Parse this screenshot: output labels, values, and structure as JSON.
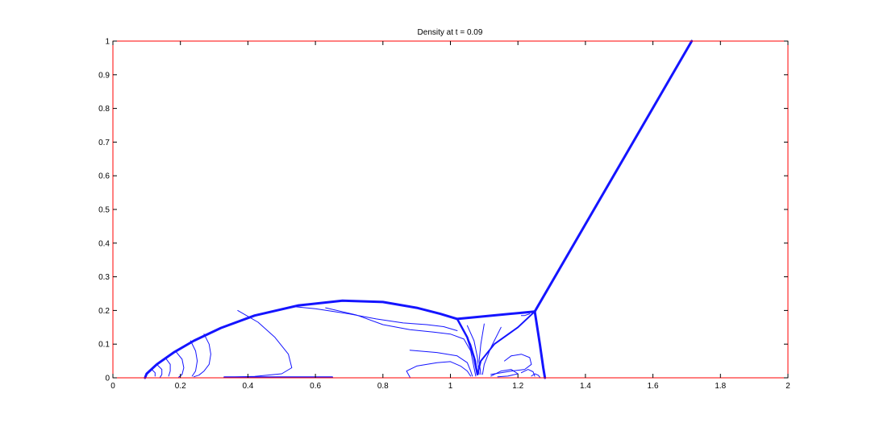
{
  "chart_data": {
    "type": "line",
    "title": "Density at t = 0.09",
    "xlabel": "",
    "ylabel": "",
    "xlim": [
      0,
      2
    ],
    "ylim": [
      0,
      1
    ],
    "grid": false,
    "x_ticks": [
      0,
      0.2,
      0.4,
      0.6,
      0.8,
      1,
      1.2,
      1.4,
      1.6,
      1.8,
      2
    ],
    "x_tick_labels": [
      "0",
      "0.2",
      "0.4",
      "0.6",
      "0.8",
      "1",
      "1.2",
      "1.4",
      "1.6",
      "1.8",
      "2"
    ],
    "y_ticks": [
      0,
      0.1,
      0.2,
      0.3,
      0.4,
      0.5,
      0.6,
      0.7,
      0.8,
      0.9,
      1
    ],
    "y_tick_labels": [
      "0",
      "0.1",
      "0.2",
      "0.3",
      "0.4",
      "0.5",
      "0.6",
      "0.7",
      "0.8",
      "0.9",
      "1"
    ],
    "colors": {
      "contour": "#1414ff",
      "frame": "#ff0000",
      "tick": "#000000"
    },
    "series": [
      {
        "width": 3,
        "points": [
          [
            0.095,
            0
          ],
          [
            0.1,
            0.012
          ],
          [
            0.13,
            0.04
          ],
          [
            0.18,
            0.075
          ],
          [
            0.24,
            0.11
          ],
          [
            0.32,
            0.148
          ],
          [
            0.42,
            0.185
          ],
          [
            0.55,
            0.215
          ],
          [
            0.68,
            0.229
          ],
          [
            0.8,
            0.225
          ],
          [
            0.9,
            0.208
          ],
          [
            0.97,
            0.19
          ],
          [
            1.02,
            0.175
          ]
        ]
      },
      {
        "width": 3,
        "points": [
          [
            1.02,
            0.175
          ],
          [
            1.25,
            0.197
          ]
        ]
      },
      {
        "width": 3,
        "points": [
          [
            1.25,
            0.197
          ],
          [
            1.715,
            1
          ]
        ]
      },
      {
        "width": 3,
        "points": [
          [
            1.25,
            0.197
          ],
          [
            1.265,
            0.1
          ],
          [
            1.275,
            0.03
          ],
          [
            1.28,
            0
          ]
        ]
      },
      {
        "width": 2.5,
        "points": [
          [
            1.02,
            0.175
          ],
          [
            1.05,
            0.12
          ],
          [
            1.07,
            0.06
          ],
          [
            1.08,
            0.01
          ]
        ]
      },
      {
        "width": 2,
        "points": [
          [
            1.25,
            0.197
          ],
          [
            1.2,
            0.15
          ],
          [
            1.13,
            0.1
          ],
          [
            1.09,
            0.05
          ],
          [
            1.08,
            0.01
          ]
        ]
      },
      {
        "width": 1,
        "points": [
          [
            0.53,
            0.212
          ],
          [
            0.6,
            0.205
          ],
          [
            0.7,
            0.19
          ],
          [
            0.78,
            0.175
          ],
          [
            0.86,
            0.163
          ],
          [
            0.93,
            0.158
          ],
          [
            0.98,
            0.152
          ],
          [
            1.02,
            0.14
          ]
        ]
      },
      {
        "width": 1,
        "points": [
          [
            0.63,
            0.208
          ],
          [
            0.72,
            0.187
          ],
          [
            0.8,
            0.158
          ],
          [
            0.88,
            0.143
          ],
          [
            0.95,
            0.136
          ],
          [
            1.0,
            0.13
          ],
          [
            1.04,
            0.115
          ],
          [
            1.06,
            0.08
          ],
          [
            1.07,
            0.03
          ],
          [
            1.075,
            0.005
          ]
        ]
      },
      {
        "width": 1,
        "points": [
          [
            0.88,
            0.082
          ],
          [
            0.96,
            0.075
          ],
          [
            1.02,
            0.065
          ],
          [
            1.05,
            0.045
          ],
          [
            1.06,
            0.02
          ],
          [
            1.065,
            0.005
          ]
        ]
      },
      {
        "width": 1,
        "points": [
          [
            0.88,
            0.002
          ],
          [
            0.87,
            0.02
          ],
          [
            0.9,
            0.035
          ],
          [
            0.96,
            0.045
          ],
          [
            1.0,
            0.048
          ],
          [
            1.03,
            0.035
          ],
          [
            1.05,
            0.02
          ],
          [
            1.06,
            0.005
          ]
        ]
      },
      {
        "width": 1,
        "points": [
          [
            1.04,
            0.14
          ],
          [
            1.06,
            0.1
          ],
          [
            1.075,
            0.05
          ],
          [
            1.08,
            0.01
          ]
        ]
      },
      {
        "width": 1,
        "points": [
          [
            1.05,
            0.155
          ],
          [
            1.07,
            0.11
          ],
          [
            1.08,
            0.06
          ],
          [
            1.085,
            0.01
          ]
        ]
      },
      {
        "width": 1,
        "points": [
          [
            1.1,
            0.16
          ],
          [
            1.09,
            0.1
          ],
          [
            1.085,
            0.05
          ],
          [
            1.09,
            0.01
          ]
        ]
      },
      {
        "width": 1,
        "points": [
          [
            1.15,
            0.15
          ],
          [
            1.12,
            0.09
          ],
          [
            1.1,
            0.04
          ],
          [
            1.095,
            0.01
          ]
        ]
      },
      {
        "width": 1,
        "points": [
          [
            1.21,
            0.185
          ],
          [
            1.22,
            0.185
          ],
          [
            1.235,
            0.19
          ]
        ]
      },
      {
        "width": 1,
        "points": [
          [
            1.16,
            0.05
          ],
          [
            1.18,
            0.065
          ],
          [
            1.21,
            0.07
          ],
          [
            1.235,
            0.06
          ],
          [
            1.24,
            0.04
          ],
          [
            1.22,
            0.025
          ],
          [
            1.18,
            0.02
          ],
          [
            1.15,
            0.015
          ],
          [
            1.12,
            0.01
          ]
        ]
      },
      {
        "width": 1,
        "points": [
          [
            1.12,
            0.005
          ],
          [
            1.15,
            0.02
          ],
          [
            1.18,
            0.025
          ],
          [
            1.2,
            0.012
          ],
          [
            1.17,
            0.005
          ],
          [
            1.14,
            0.003
          ]
        ]
      },
      {
        "width": 1,
        "points": [
          [
            1.21,
            0.015
          ],
          [
            1.23,
            0.025
          ],
          [
            1.245,
            0.018
          ],
          [
            1.25,
            0.005
          ]
        ]
      },
      {
        "width": 1,
        "points": [
          [
            1.24,
            0.005
          ],
          [
            1.25,
            0.012
          ],
          [
            1.26,
            0.008
          ],
          [
            1.265,
            0.002
          ]
        ]
      },
      {
        "width": 1,
        "points": [
          [
            0.37,
            0.2
          ],
          [
            0.43,
            0.165
          ],
          [
            0.48,
            0.12
          ],
          [
            0.52,
            0.07
          ],
          [
            0.53,
            0.03
          ],
          [
            0.5,
            0.012
          ],
          [
            0.42,
            0.004
          ],
          [
            0.34,
            0.002
          ]
        ]
      },
      {
        "width": 1,
        "points": [
          [
            0.27,
            0.13
          ],
          [
            0.285,
            0.1
          ],
          [
            0.29,
            0.07
          ],
          [
            0.285,
            0.04
          ],
          [
            0.27,
            0.02
          ],
          [
            0.255,
            0.008
          ],
          [
            0.24,
            0.003
          ]
        ]
      },
      {
        "width": 1,
        "points": [
          [
            0.23,
            0.11
          ],
          [
            0.245,
            0.08
          ],
          [
            0.25,
            0.05
          ],
          [
            0.245,
            0.02
          ],
          [
            0.235,
            0.005
          ]
        ]
      },
      {
        "width": 1,
        "points": [
          [
            0.185,
            0.08
          ],
          [
            0.205,
            0.055
          ],
          [
            0.21,
            0.03
          ],
          [
            0.205,
            0.01
          ],
          [
            0.195,
            0.002
          ]
        ]
      },
      {
        "width": 1,
        "points": [
          [
            0.155,
            0.06
          ],
          [
            0.17,
            0.04
          ],
          [
            0.17,
            0.02
          ],
          [
            0.165,
            0.005
          ]
        ]
      },
      {
        "width": 1,
        "points": [
          [
            0.13,
            0.04
          ],
          [
            0.145,
            0.025
          ],
          [
            0.145,
            0.01
          ],
          [
            0.14,
            0.002
          ]
        ]
      },
      {
        "width": 1,
        "points": [
          [
            0.115,
            0.025
          ],
          [
            0.125,
            0.015
          ],
          [
            0.125,
            0.005
          ]
        ]
      },
      {
        "width": 2,
        "points": [
          [
            0.33,
            0.002
          ],
          [
            0.65,
            0.002
          ]
        ]
      }
    ]
  }
}
